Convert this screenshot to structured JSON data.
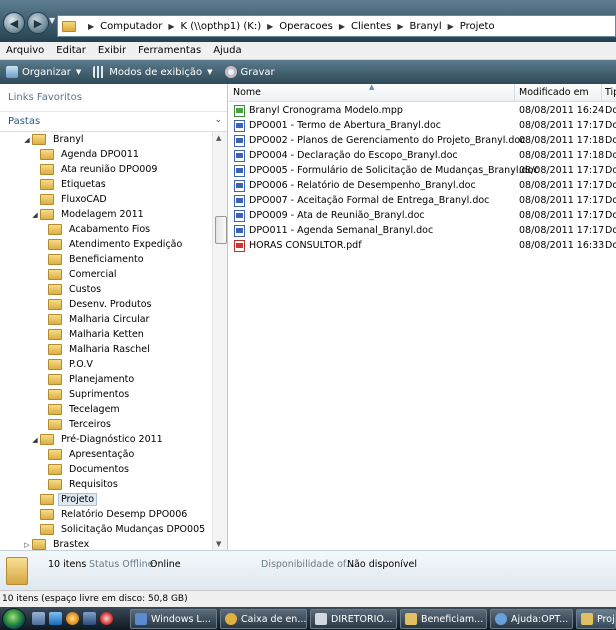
{
  "address": {
    "crumbs": [
      "Computador",
      "K (\\\\opthp1) (K:)",
      "Operacoes",
      "Clientes",
      "Branyl",
      "Projeto"
    ]
  },
  "menu": [
    "Arquivo",
    "Editar",
    "Exibir",
    "Ferramentas",
    "Ajuda"
  ],
  "toolbar": {
    "organize_label": "Organizar",
    "views_label": "Modos de exibição",
    "burn_label": "Gravar"
  },
  "navigation": {
    "favorites_label": "Links Favoritos",
    "folders_label": "Pastas"
  },
  "tree": [
    {
      "label": "Branyl",
      "level": 1,
      "expander": "open"
    },
    {
      "label": "Agenda DPO011",
      "level": 2,
      "expander": "none"
    },
    {
      "label": "Ata reunião DPO009",
      "level": 2,
      "expander": "none"
    },
    {
      "label": "Etiquetas",
      "level": 2,
      "expander": "none"
    },
    {
      "label": "FluxoCAD",
      "level": 2,
      "expander": "none"
    },
    {
      "label": "Modelagem 2011",
      "level": 2,
      "expander": "open"
    },
    {
      "label": "Acabamento Fios",
      "level": 3,
      "expander": "none"
    },
    {
      "label": "Atendimento Expedição",
      "level": 3,
      "expander": "none"
    },
    {
      "label": "Beneficiamento",
      "level": 3,
      "expander": "none"
    },
    {
      "label": "Comercial",
      "level": 3,
      "expander": "none"
    },
    {
      "label": "Custos",
      "level": 3,
      "expander": "none"
    },
    {
      "label": "Desenv. Produtos",
      "level": 3,
      "expander": "none"
    },
    {
      "label": "Malharia Circular",
      "level": 3,
      "expander": "none"
    },
    {
      "label": "Malharia Ketten",
      "level": 3,
      "expander": "none"
    },
    {
      "label": "Malharia Raschel",
      "level": 3,
      "expander": "none"
    },
    {
      "label": "P.O.V",
      "level": 3,
      "expander": "none"
    },
    {
      "label": "Planejamento",
      "level": 3,
      "expander": "none"
    },
    {
      "label": "Suprimentos",
      "level": 3,
      "expander": "none"
    },
    {
      "label": "Tecelagem",
      "level": 3,
      "expander": "none"
    },
    {
      "label": "Terceiros",
      "level": 3,
      "expander": "none"
    },
    {
      "label": "Pré-Diagnóstico 2011",
      "level": 2,
      "expander": "open"
    },
    {
      "label": "Apresentação",
      "level": 3,
      "expander": "none"
    },
    {
      "label": "Documentos",
      "level": 3,
      "expander": "none"
    },
    {
      "label": "Requisitos",
      "level": 3,
      "expander": "none"
    },
    {
      "label": "Projeto",
      "level": 2,
      "expander": "none",
      "selected": true
    },
    {
      "label": "Relatório Desemp DPO006",
      "level": 2,
      "expander": "none"
    },
    {
      "label": "Solicitação Mudanças DPO005",
      "level": 2,
      "expander": "none"
    },
    {
      "label": "Brastex",
      "level": 1,
      "expander": "closed"
    }
  ],
  "columns": {
    "name": "Nome",
    "modified": "Modificado em",
    "type": "Tipo"
  },
  "files": [
    {
      "name": "Branyl Cronograma Modelo.mpp",
      "modified": "08/08/2011 16:24",
      "type": "Do",
      "icon": "mpp-icon"
    },
    {
      "name": "DPO001 - Termo de Abertura_Branyl.doc",
      "modified": "08/08/2011 17:17",
      "type": "Do",
      "icon": "doc-icon"
    },
    {
      "name": "DPO002 - Planos de Gerenciamento do Projeto_Branyl.doc",
      "modified": "08/08/2011 17:18",
      "type": "Do",
      "icon": "doc-icon"
    },
    {
      "name": "DPO004 - Declaração do Escopo_Branyl.doc",
      "modified": "08/08/2011 17:18",
      "type": "Do",
      "icon": "doc-icon"
    },
    {
      "name": "DPO005 - Formulário de Solicitação de Mudanças_Branyl.doc",
      "modified": "08/08/2011 17:17",
      "type": "Do",
      "icon": "doc-icon"
    },
    {
      "name": "DPO006 - Relatório de Desempenho_Branyl.doc",
      "modified": "08/08/2011 17:17",
      "type": "Do",
      "icon": "doc-icon"
    },
    {
      "name": "DPO007 - Aceitação Formal de Entrega_Branyl.doc",
      "modified": "08/08/2011 17:17",
      "type": "Do",
      "icon": "doc-icon"
    },
    {
      "name": "DPO009 - Ata de Reunião_Branyl.doc",
      "modified": "08/08/2011 17:17",
      "type": "Do",
      "icon": "doc-icon"
    },
    {
      "name": "DPO011 - Agenda Semanal_Branyl.doc",
      "modified": "08/08/2011 17:17",
      "type": "Do",
      "icon": "doc-icon"
    },
    {
      "name": "HORAS CONSULTOR.pdf",
      "modified": "08/08/2011 16:33",
      "type": "Do",
      "icon": "pdf-icon"
    }
  ],
  "details": {
    "count": "10 itens",
    "offline_label": "Status Offline:",
    "offline_value": "Online",
    "availability_label": "Disponibilidade of...",
    "availability_value": "Não disponível"
  },
  "status": {
    "text": "10 itens (espaço livre em disco: 50,8 GB)"
  },
  "taskbar": {
    "buttons": [
      "Windows L...",
      "Caixa de en...",
      "DIRETORIO...",
      "Beneficiam...",
      "Ajuda:OPT...",
      "Proje"
    ]
  }
}
